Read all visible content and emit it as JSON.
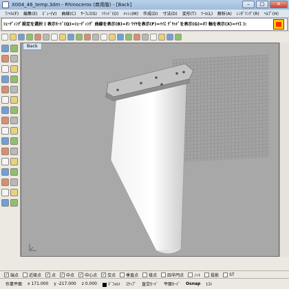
{
  "window": {
    "title": "X004_46_temp.3dm - Rhinoceros (商用版) - [Back]"
  },
  "window_buttons": {
    "minimize": "–",
    "maximize": "□",
    "close": "✕"
  },
  "menubar": [
    "ﾌｧｲﾙ(F)",
    "編集(E)",
    "ﾋﾞｭｰ(V)",
    "曲線(C)",
    "ｻｰﾌｪｽ(S)",
    "ｿﾘｯﾄﾞ(O)",
    "ﾒｯｼｭ(M)",
    "作成(D)",
    "寸法(D)",
    "変形(T)",
    "ﾂｰﾙ(L)",
    "解析(A)",
    "ﾚﾝﾀﾞﾘﾝｸﾞ(R)",
    "ﾍﾙﾌﾟ(H)"
  ],
  "command": {
    "prompt": "ｼｪｰﾃﾞｨﾝｸﾞ設定を選択 ( 表示ﾓｰﾄﾞ(Q)=ｼｪｰﾃﾞｨﾝｸﾞ 曲線を表示(B)=ｵﾝ ﾜｲﾔを表示(F)=ｲｲｴ ｸﾞﾘｯﾄﾞを表示(G)=ｵﾌ 軸を表示(X)=ｲｲｴ ):"
  },
  "viewport": {
    "tab": "Back"
  },
  "osnaps": [
    {
      "label": "端点",
      "checked": true
    },
    {
      "label": "近接点",
      "checked": false
    },
    {
      "label": "点",
      "checked": true
    },
    {
      "label": "中点",
      "checked": true
    },
    {
      "label": "中心点",
      "checked": true
    },
    {
      "label": "交点",
      "checked": true
    },
    {
      "label": "垂直点",
      "checked": false
    },
    {
      "label": "接点",
      "checked": false
    },
    {
      "label": "四半円点",
      "checked": false
    },
    {
      "label": "ﾉｯﾄ",
      "checked": false
    },
    {
      "label": "投影",
      "checked": false
    },
    {
      "label": "ST",
      "checked": false
    }
  ],
  "status": {
    "cplane": "作業平面",
    "x": "x 171.000",
    "y": "y -217.000",
    "z": "z 0.000",
    "layer": "ﾃﾞﾌｫﾙﾄ",
    "snap": "ｽﾅｯﾌﾟ",
    "ortho": "直交ﾓｰﾄﾞ",
    "planar": "平面ﾓｰﾄﾞ",
    "osnap": "Osnap",
    "history": "ﾋｽﾄ"
  },
  "colors": {
    "swatch_outer": "#ffd000",
    "swatch_inner": "#ff2a00",
    "viewport_bg": "#a8a8a8",
    "tab_bg": "#d6e4f4"
  },
  "icons": [
    "new-file-icon",
    "open-icon",
    "save-icon",
    "print-icon",
    "cut-icon",
    "copy-icon",
    "paste-icon",
    "undo-icon",
    "redo-icon",
    "pan-icon",
    "rotate-view-icon",
    "zoom-icon",
    "zoom-window-icon",
    "zoom-extents-icon",
    "viewport-icon",
    "layer-icon",
    "properties-icon",
    "shade-icon",
    "render-icon",
    "light-icon",
    "options-icon",
    "help-icon"
  ]
}
